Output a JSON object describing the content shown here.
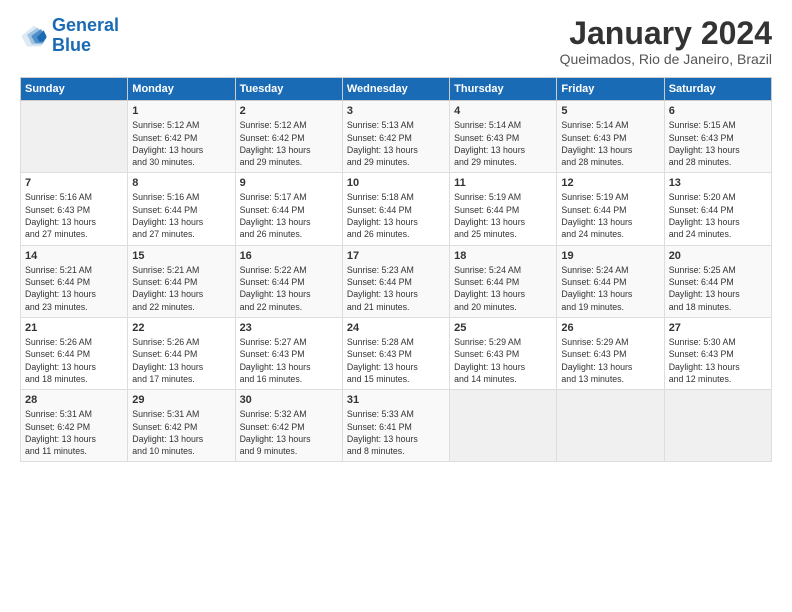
{
  "logo": {
    "line1": "General",
    "line2": "Blue"
  },
  "header": {
    "title": "January 2024",
    "subtitle": "Queimados, Rio de Janeiro, Brazil"
  },
  "days_of_week": [
    "Sunday",
    "Monday",
    "Tuesday",
    "Wednesday",
    "Thursday",
    "Friday",
    "Saturday"
  ],
  "weeks": [
    [
      {
        "day": "",
        "empty": true
      },
      {
        "day": "1",
        "sunrise": "5:12 AM",
        "sunset": "6:42 PM",
        "daylight": "13 hours and 30 minutes."
      },
      {
        "day": "2",
        "sunrise": "5:12 AM",
        "sunset": "6:42 PM",
        "daylight": "13 hours and 29 minutes."
      },
      {
        "day": "3",
        "sunrise": "5:13 AM",
        "sunset": "6:42 PM",
        "daylight": "13 hours and 29 minutes."
      },
      {
        "day": "4",
        "sunrise": "5:14 AM",
        "sunset": "6:43 PM",
        "daylight": "13 hours and 29 minutes."
      },
      {
        "day": "5",
        "sunrise": "5:14 AM",
        "sunset": "6:43 PM",
        "daylight": "13 hours and 28 minutes."
      },
      {
        "day": "6",
        "sunrise": "5:15 AM",
        "sunset": "6:43 PM",
        "daylight": "13 hours and 28 minutes."
      }
    ],
    [
      {
        "day": "7",
        "sunrise": "5:16 AM",
        "sunset": "6:43 PM",
        "daylight": "13 hours and 27 minutes."
      },
      {
        "day": "8",
        "sunrise": "5:16 AM",
        "sunset": "6:44 PM",
        "daylight": "13 hours and 27 minutes."
      },
      {
        "day": "9",
        "sunrise": "5:17 AM",
        "sunset": "6:44 PM",
        "daylight": "13 hours and 26 minutes."
      },
      {
        "day": "10",
        "sunrise": "5:18 AM",
        "sunset": "6:44 PM",
        "daylight": "13 hours and 26 minutes."
      },
      {
        "day": "11",
        "sunrise": "5:19 AM",
        "sunset": "6:44 PM",
        "daylight": "13 hours and 25 minutes."
      },
      {
        "day": "12",
        "sunrise": "5:19 AM",
        "sunset": "6:44 PM",
        "daylight": "13 hours and 24 minutes."
      },
      {
        "day": "13",
        "sunrise": "5:20 AM",
        "sunset": "6:44 PM",
        "daylight": "13 hours and 24 minutes."
      }
    ],
    [
      {
        "day": "14",
        "sunrise": "5:21 AM",
        "sunset": "6:44 PM",
        "daylight": "13 hours and 23 minutes."
      },
      {
        "day": "15",
        "sunrise": "5:21 AM",
        "sunset": "6:44 PM",
        "daylight": "13 hours and 22 minutes."
      },
      {
        "day": "16",
        "sunrise": "5:22 AM",
        "sunset": "6:44 PM",
        "daylight": "13 hours and 22 minutes."
      },
      {
        "day": "17",
        "sunrise": "5:23 AM",
        "sunset": "6:44 PM",
        "daylight": "13 hours and 21 minutes."
      },
      {
        "day": "18",
        "sunrise": "5:24 AM",
        "sunset": "6:44 PM",
        "daylight": "13 hours and 20 minutes."
      },
      {
        "day": "19",
        "sunrise": "5:24 AM",
        "sunset": "6:44 PM",
        "daylight": "13 hours and 19 minutes."
      },
      {
        "day": "20",
        "sunrise": "5:25 AM",
        "sunset": "6:44 PM",
        "daylight": "13 hours and 18 minutes."
      }
    ],
    [
      {
        "day": "21",
        "sunrise": "5:26 AM",
        "sunset": "6:44 PM",
        "daylight": "13 hours and 18 minutes."
      },
      {
        "day": "22",
        "sunrise": "5:26 AM",
        "sunset": "6:44 PM",
        "daylight": "13 hours and 17 minutes."
      },
      {
        "day": "23",
        "sunrise": "5:27 AM",
        "sunset": "6:43 PM",
        "daylight": "13 hours and 16 minutes."
      },
      {
        "day": "24",
        "sunrise": "5:28 AM",
        "sunset": "6:43 PM",
        "daylight": "13 hours and 15 minutes."
      },
      {
        "day": "25",
        "sunrise": "5:29 AM",
        "sunset": "6:43 PM",
        "daylight": "13 hours and 14 minutes."
      },
      {
        "day": "26",
        "sunrise": "5:29 AM",
        "sunset": "6:43 PM",
        "daylight": "13 hours and 13 minutes."
      },
      {
        "day": "27",
        "sunrise": "5:30 AM",
        "sunset": "6:43 PM",
        "daylight": "13 hours and 12 minutes."
      }
    ],
    [
      {
        "day": "28",
        "sunrise": "5:31 AM",
        "sunset": "6:42 PM",
        "daylight": "13 hours and 11 minutes."
      },
      {
        "day": "29",
        "sunrise": "5:31 AM",
        "sunset": "6:42 PM",
        "daylight": "13 hours and 10 minutes."
      },
      {
        "day": "30",
        "sunrise": "5:32 AM",
        "sunset": "6:42 PM",
        "daylight": "13 hours and 9 minutes."
      },
      {
        "day": "31",
        "sunrise": "5:33 AM",
        "sunset": "6:41 PM",
        "daylight": "13 hours and 8 minutes."
      },
      {
        "day": "",
        "empty": true
      },
      {
        "day": "",
        "empty": true
      },
      {
        "day": "",
        "empty": true
      }
    ]
  ],
  "labels": {
    "sunrise": "Sunrise:",
    "sunset": "Sunset:",
    "daylight": "Daylight:"
  }
}
